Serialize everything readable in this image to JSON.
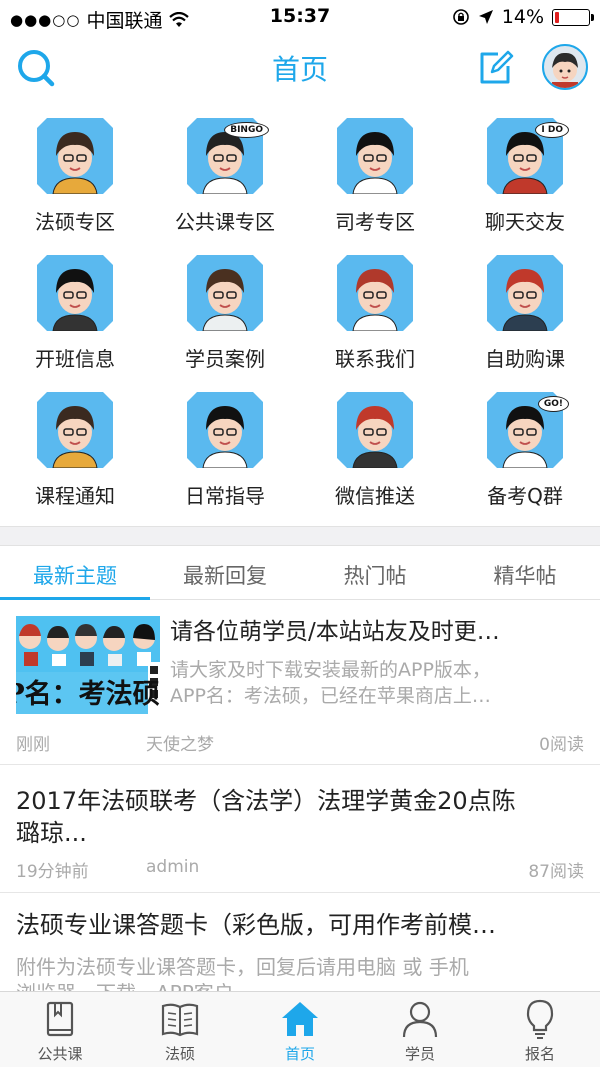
{
  "status_bar": {
    "carrier": "中国联通",
    "time": "15:37",
    "battery": "14%",
    "battery_level": 0.14
  },
  "nav": {
    "title": "首页",
    "search_icon": "search-icon",
    "edit_icon": "edit-icon",
    "avatar": "user-avatar"
  },
  "grid": [
    {
      "label": "法硕专区",
      "speech": ""
    },
    {
      "label": "公共课专区",
      "speech": "BINGO"
    },
    {
      "label": "司考专区",
      "speech": ""
    },
    {
      "label": "聊天交友",
      "speech": "I DO"
    },
    {
      "label": "开班信息",
      "speech": ""
    },
    {
      "label": "学员案例",
      "speech": ""
    },
    {
      "label": "联系我们",
      "speech": ""
    },
    {
      "label": "自助购课",
      "speech": ""
    },
    {
      "label": "课程通知",
      "speech": ""
    },
    {
      "label": "日常指导",
      "speech": ""
    },
    {
      "label": "微信推送",
      "speech": ""
    },
    {
      "label": "备考Q群",
      "speech": "GO!"
    }
  ],
  "tabs": [
    {
      "label": "最新主题",
      "active": true
    },
    {
      "label": "最新回复",
      "active": false
    },
    {
      "label": "热门帖",
      "active": false
    },
    {
      "label": "精华帖",
      "active": false
    }
  ],
  "posts": [
    {
      "title": "请各位萌学员/本站站友及时更…",
      "summary_line1": "请大家及时下载安装最新的APP版本，",
      "summary_line2": "APP名：考法硕，已经在苹果商店上…",
      "thumbnail_text": "P名：考法硕",
      "time": "刚刚",
      "author": "天使之梦",
      "reads": "0阅读"
    },
    {
      "title_line1": "2017年法硕联考（含法学）法理学黄金20点陈",
      "title_line2": "璐琼...",
      "time": "19分钟前",
      "author": "admin",
      "reads": "87阅读"
    },
    {
      "title": "法硕专业课答题卡（彩色版，可用作考前模…",
      "summary_line1": "附件为法硕专业课答题卡，回复后请用电脑  或  手机",
      "summary_line2": "浏览器，下载，APP客户"
    }
  ],
  "tabbar": [
    {
      "label": "公共课",
      "icon": "book-icon",
      "active": false
    },
    {
      "label": "法硕",
      "icon": "open-book-icon",
      "active": false
    },
    {
      "label": "首页",
      "icon": "home-icon",
      "active": true
    },
    {
      "label": "学员",
      "icon": "person-icon",
      "active": false
    },
    {
      "label": "报名",
      "icon": "lightbulb-icon",
      "active": false
    }
  ],
  "colors": {
    "accent": "#1ea7ea",
    "battery_low": "#e02020"
  }
}
